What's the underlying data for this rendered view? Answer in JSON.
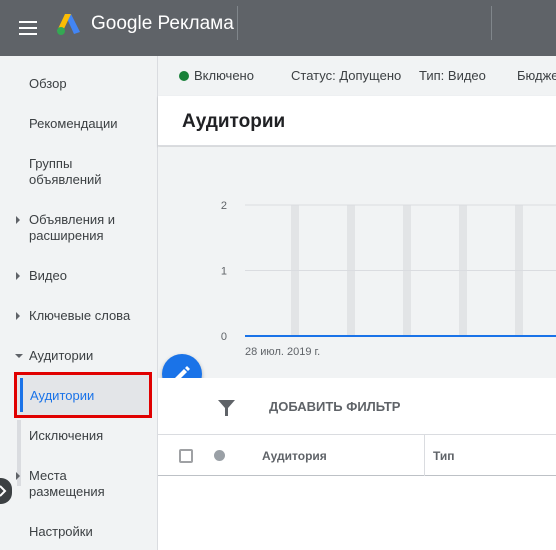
{
  "header": {
    "brand": "Google Реклама",
    "menu_icon": "hamburger-menu-icon",
    "logo_icon": "google-ads-logo",
    "colors": {
      "bar": "#5f6368",
      "logo_yellow": "#fbbc04",
      "logo_blue": "#4285f4",
      "logo_green": "#34a853"
    }
  },
  "sidebar": {
    "items": [
      {
        "label": "Обзор"
      },
      {
        "label": "Рекомендации"
      },
      {
        "label": "Группы объявлений"
      },
      {
        "label": "Объявления и расширения"
      },
      {
        "label": "Видео"
      },
      {
        "label": "Ключевые слова"
      },
      {
        "label": "Аудитории"
      },
      {
        "label": "Аудитории",
        "active": true
      },
      {
        "label": "Исключения"
      },
      {
        "label": "Места размещения"
      },
      {
        "label": "Настройки"
      }
    ],
    "active_color": "#1a73e8",
    "highlight_color": "#e00000"
  },
  "statusbar": {
    "enabled": "Включено",
    "status": "Статус: Допущено",
    "type": "Тип: Видео",
    "budget": "Бюдже",
    "enabled_color": "#188038"
  },
  "page": {
    "title": "Аудитории"
  },
  "chart_data": {
    "type": "line",
    "y_ticks": [
      "2",
      "1",
      "0"
    ],
    "ylim": [
      0,
      2
    ],
    "x_start_label": "28 июл. 2019 г.",
    "values": [
      0,
      0,
      0,
      0,
      0,
      0,
      0
    ],
    "line_color": "#1a73e8"
  },
  "fab": {
    "icon": "edit-pencil-icon"
  },
  "filter": {
    "icon": "filter-icon",
    "label": "ДОБАВИТЬ ФИЛЬТР"
  },
  "table": {
    "columns": [
      "Аудитория",
      "Тип"
    ]
  }
}
